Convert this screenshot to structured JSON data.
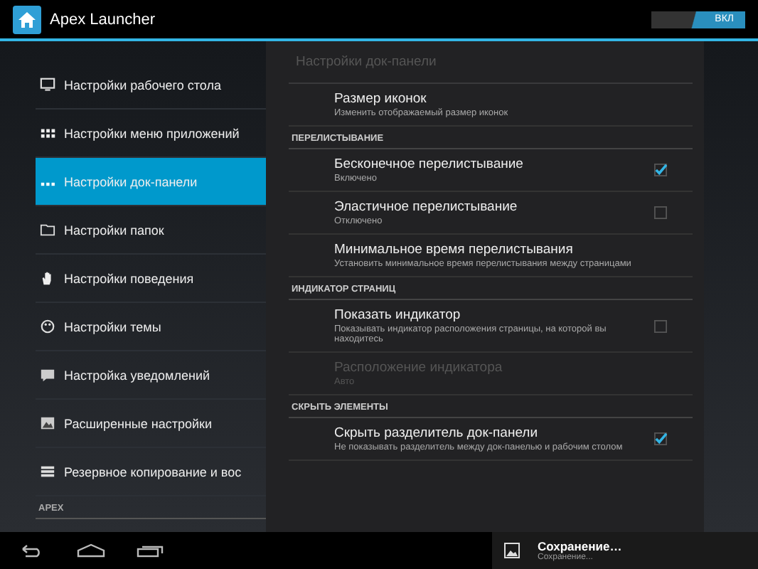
{
  "action_bar": {
    "title": "Apex Launcher",
    "switch": {
      "label": "ВКЛ",
      "on": true
    }
  },
  "sidebar": {
    "items": [
      {
        "label": "Настройки рабочего стола",
        "selected": false
      },
      {
        "label": "Настройки меню приложений",
        "selected": false
      },
      {
        "label": "Настройки док-панели",
        "selected": true
      },
      {
        "label": "Настройки папок",
        "selected": false
      },
      {
        "label": "Настройки поведения",
        "selected": false
      },
      {
        "label": "Настройки темы",
        "selected": false
      },
      {
        "label": "Настройка уведомлений",
        "selected": false
      },
      {
        "label": "Расширенные настройки",
        "selected": false
      },
      {
        "label": "Резервное копирование и вос",
        "selected": false
      }
    ],
    "section": "APEX"
  },
  "panel": {
    "title": "Настройки док-панели",
    "items": [
      {
        "kind": "pref",
        "title": "Размер иконок",
        "summary": "Изменить отображаемый размер иконок",
        "disabled": false
      },
      {
        "kind": "header",
        "title": "ПЕРЕЛИСТЫВАНИЕ"
      },
      {
        "kind": "checkbox",
        "title": "Бесконечное перелистывание",
        "summary": "Включено",
        "checked": true,
        "disabled": false
      },
      {
        "kind": "checkbox",
        "title": "Эластичное перелистывание",
        "summary": "Отключено",
        "checked": false,
        "disabled": false
      },
      {
        "kind": "pref",
        "title": "Минимальное время перелистывания",
        "summary": "Установить минимальное время перелистывания между страницами",
        "disabled": false
      },
      {
        "kind": "header",
        "title": "ИНДИКАТОР СТРАНИЦ"
      },
      {
        "kind": "checkbox",
        "title": "Показать индикатор",
        "summary": "Показывать индикатор расположения страницы, на которой вы находитесь",
        "checked": false,
        "disabled": false
      },
      {
        "kind": "pref",
        "title": "Расположение индикатора",
        "summary": "Авто",
        "disabled": true
      },
      {
        "kind": "header",
        "title": "СКРЫТЬ ЭЛЕМЕНТЫ"
      },
      {
        "kind": "checkbox",
        "title": "Скрыть разделитель док-панели",
        "summary": "Не показывать разделитель между док-панелью и рабочим столом",
        "checked": true,
        "disabled": false
      }
    ]
  },
  "notification": {
    "title": "Сохранение…",
    "text": "Сохранение..."
  }
}
